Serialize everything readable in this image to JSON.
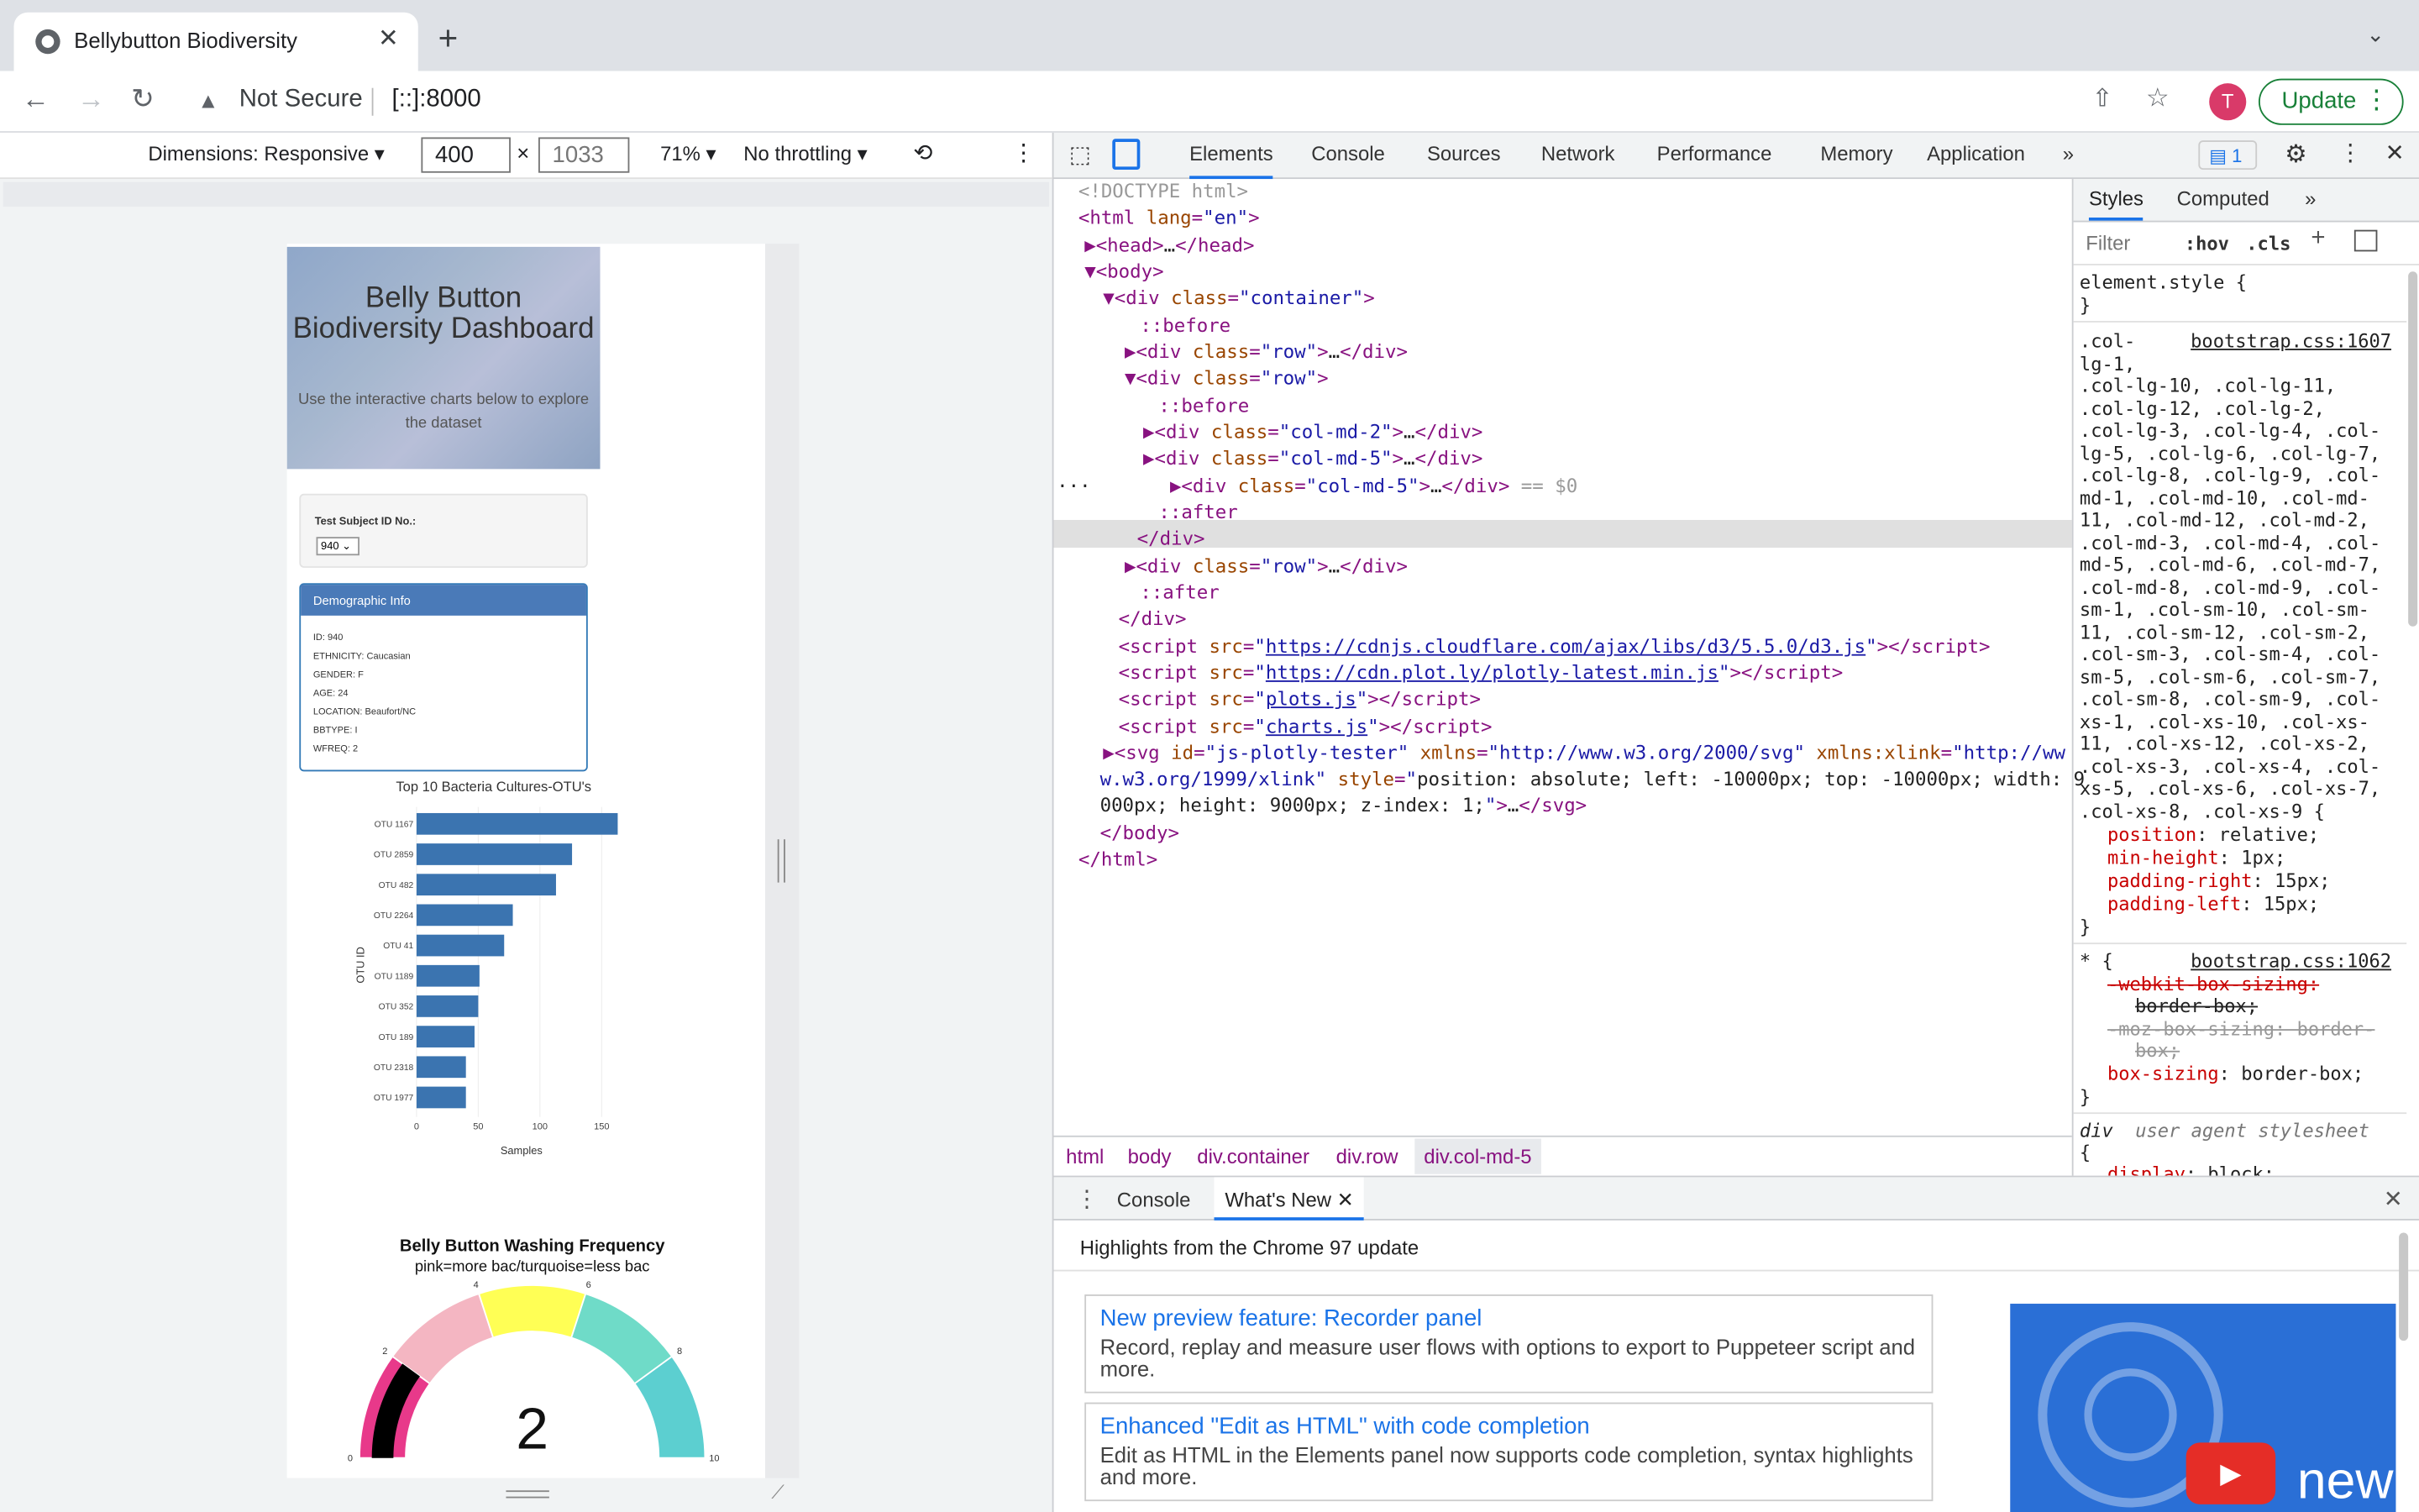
{
  "browser": {
    "tab_title": "Bellybutton Biodiversity",
    "address_security": "Not Secure",
    "url": "[::]:8000",
    "avatar_letter": "T",
    "update_label": "Update"
  },
  "device_toolbar": {
    "dimensions_label": "Dimensions: Responsive ▾",
    "width": "400",
    "height": "1033",
    "zoom": "71% ▾",
    "throttling": "No throttling ▾"
  },
  "page": {
    "title": "Belly Button Biodiversity Dashboard",
    "subtitle": "Use the interactive charts below to explore the dataset",
    "select_label": "Test Subject ID No.:",
    "select_value": "940",
    "panel_heading": "Demographic Info",
    "demographics": [
      "ID: 940",
      "ETHNICITY: Caucasian",
      "GENDER: F",
      "AGE: 24",
      "LOCATION: Beaufort/NC",
      "BBTYPE: I",
      "WFREQ: 2"
    ]
  },
  "chart_data": [
    {
      "type": "bar",
      "orientation": "horizontal",
      "title": "Top 10 Bacteria Cultures-OTU's",
      "xlabel": "Samples",
      "ylabel": "OTU ID",
      "categories": [
        "OTU 1167",
        "OTU 2859",
        "OTU 482",
        "OTU 2264",
        "OTU 41",
        "OTU 1189",
        "OTU 352",
        "OTU 189",
        "OTU 2318",
        "OTU 1977"
      ],
      "values": [
        163,
        126,
        113,
        78,
        71,
        51,
        50,
        47,
        40,
        40
      ],
      "xticks": [
        "0",
        "50",
        "100",
        "150"
      ],
      "xlim": [
        0,
        170
      ],
      "color": "#3b74b0"
    },
    {
      "type": "gauge",
      "title": "Belly Button Washing Frequency",
      "subtitle": "pink=more bac/turquoise=less bac",
      "value": 2,
      "value_label": "2",
      "range": [
        0,
        10
      ],
      "ticks": [
        "0",
        "2",
        "4",
        "6",
        "8",
        "10"
      ],
      "steps": [
        {
          "range": [
            0,
            2
          ],
          "color": "#e8398a"
        },
        {
          "range": [
            2,
            4
          ],
          "color": "#f4b6c2"
        },
        {
          "range": [
            4,
            6
          ],
          "color": "#ffff55"
        },
        {
          "range": [
            6,
            8
          ],
          "color": "#6fdbc8"
        },
        {
          "range": [
            8,
            10
          ],
          "color": "#5ccfd0"
        }
      ],
      "bar_color": "#000000"
    }
  ],
  "devtools": {
    "tabs": [
      "Elements",
      "Console",
      "Sources",
      "Network",
      "Performance",
      "Memory",
      "Application",
      "»"
    ],
    "issues_count": "1",
    "breadcrumbs": [
      "html",
      "body",
      "div.container",
      "div.row",
      "div.col-md-5"
    ],
    "styles_tabs": [
      "Styles",
      "Computed",
      "»"
    ],
    "filter_placeholder": "Filter",
    "hov": ":hov",
    "cls": ".cls",
    "drawer_tabs": [
      "Console",
      "What's New"
    ],
    "drawer_heading": "Highlights from the Chrome 97 update",
    "cards": [
      {
        "title": "New preview feature: Recorder panel",
        "desc": "Record, replay and measure user flows with options to export to Puppeteer script and more."
      },
      {
        "title": "Enhanced \"Edit as HTML\" with code completion",
        "desc": "Edit as HTML in the Elements panel now supports code completion, syntax highlights and more."
      }
    ],
    "video_text": "new"
  }
}
